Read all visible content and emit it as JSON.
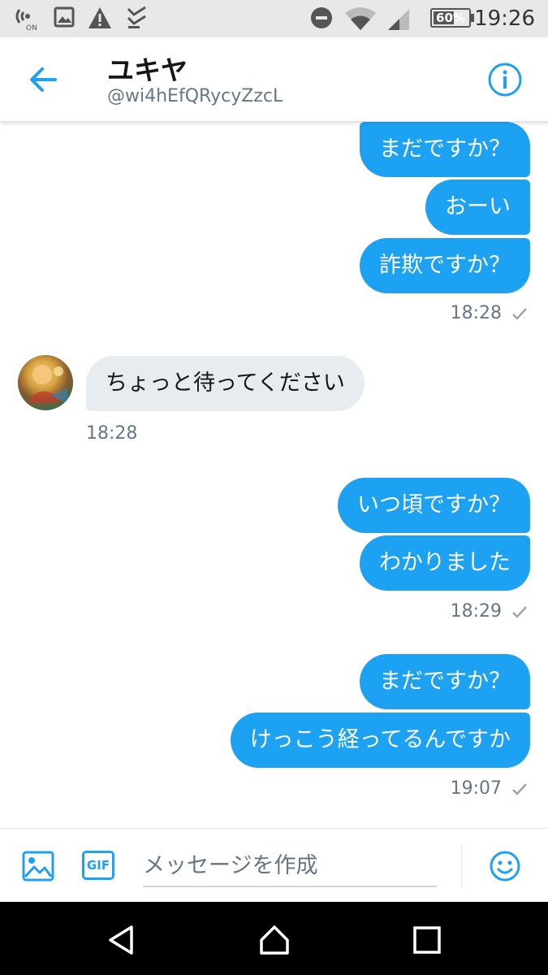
{
  "status_bar": {
    "time": "19:26",
    "battery": "60%",
    "battery_level": 0.6,
    "icons": [
      "nfc-on-icon",
      "image-icon",
      "warning-icon",
      "checklist-icon",
      "do-not-disturb-icon",
      "wifi-icon",
      "signal-icon",
      "battery-icon"
    ]
  },
  "header": {
    "title": "ユキヤ",
    "handle": "@wi4hEfQRycyZzcL",
    "back_icon": "arrow-left-icon",
    "info_icon": "info-icon"
  },
  "messages": [
    {
      "text": "まだですか？"
    },
    {
      "text": "おーい"
    },
    {
      "text": "詐欺ですか？"
    },
    {
      "time": "18:28"
    },
    {
      "text": "ちょっと待ってください"
    },
    {
      "time": "18:28"
    },
    {
      "text": "いつ頃ですか？"
    },
    {
      "text": "わかりました"
    },
    {
      "time": "18:29"
    },
    {
      "text": "まだですか？"
    },
    {
      "text": "けっこう経ってるんですか"
    },
    {
      "time": "19:07"
    }
  ],
  "composer": {
    "placeholder": "メッセージを作成",
    "gif_label": "GIF",
    "icons": [
      "image-icon",
      "gif-icon",
      "emoji-icon"
    ]
  },
  "nav_bar": {
    "icons": [
      "back-triangle-icon",
      "home-icon",
      "recents-icon"
    ]
  },
  "colors": {
    "accent": "#1da1f2",
    "incoming_bubble": "#e6ecf0",
    "secondary_text": "#657786",
    "status_bar_bg": "#e8e8e8"
  }
}
